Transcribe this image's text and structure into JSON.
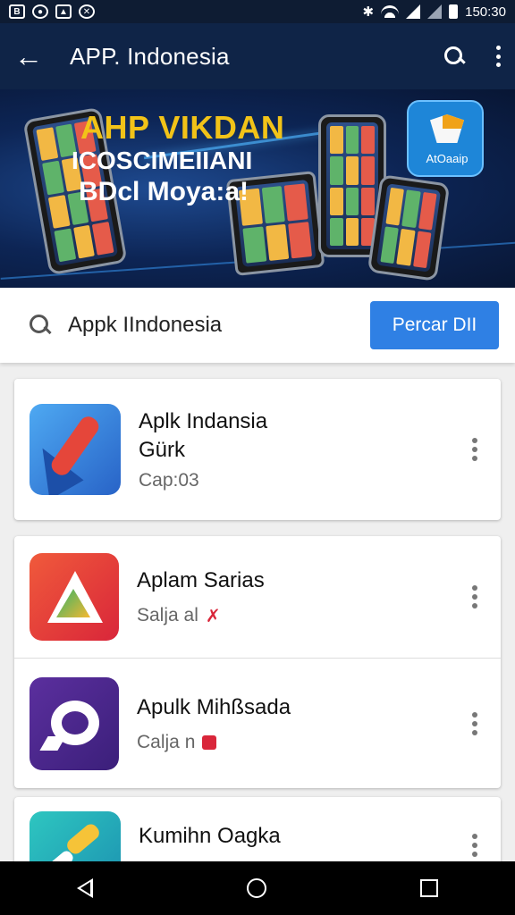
{
  "status_bar": {
    "time": "150:30",
    "icons_left": [
      "sim-icon",
      "messenger-icon",
      "photo-icon",
      "game-controller-icon"
    ],
    "icons_right": [
      "bluetooth-icon",
      "wifi-icon",
      "signal-icon",
      "signal-icon-2",
      "battery-icon"
    ]
  },
  "app_bar": {
    "title": "APP. Indonesia",
    "back_icon": "arrow-left-icon",
    "search_icon": "search-icon",
    "menu_icon": "kebab-menu-icon"
  },
  "banner": {
    "line1": "AHP VIKDAN",
    "line2": "ICOSCIMEIIANI",
    "line3": "BDcl Moya:a!",
    "badge_text": "AtOaaip"
  },
  "search": {
    "query": "Appk IIndonesia",
    "button_label": "Percar DII"
  },
  "apps": [
    {
      "name": "Aplk Indansia",
      "name2": "Gürk",
      "sub": "Cap:03",
      "icon": "pencil-arrow-icon",
      "color": "#3478d6"
    },
    {
      "name": "Aplam Sarias",
      "sub": "Salja al",
      "icon": "triangle-logo-icon",
      "color": "#e8383c"
    },
    {
      "name": "Apulk Mihßsada",
      "sub": "Calja n",
      "icon": "ring-logo-icon",
      "color": "#4a2a8c"
    },
    {
      "name": "Kumihn Oagka",
      "sub": "",
      "icon": "rocket-logo-icon",
      "color": "#22b3bd"
    }
  ],
  "nav": {
    "back": "nav-back-icon",
    "home": "nav-home-icon",
    "recent": "nav-recent-icon"
  }
}
